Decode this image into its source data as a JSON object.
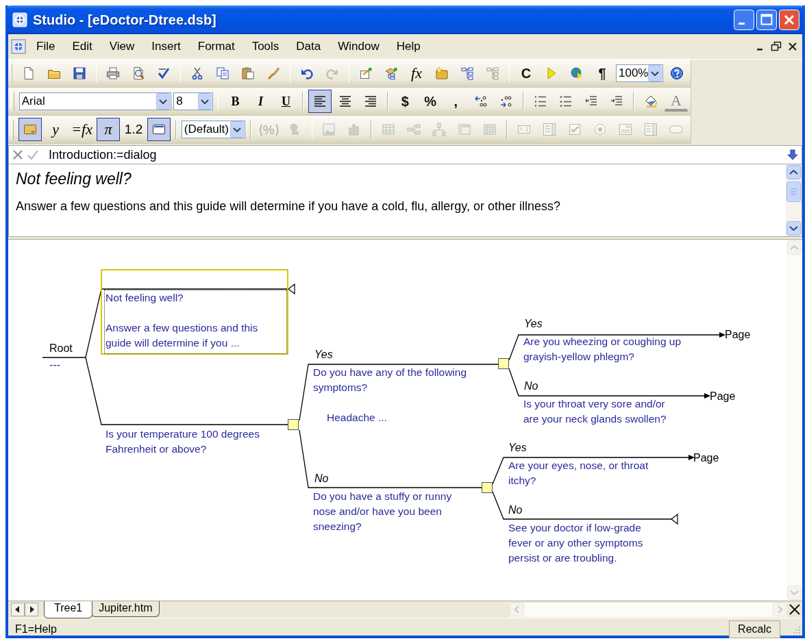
{
  "window": {
    "title": "Studio - [eDoctor-Dtree.dsb]"
  },
  "menu": [
    {
      "label": "File"
    },
    {
      "label": "Edit"
    },
    {
      "label": "View"
    },
    {
      "label": "Insert"
    },
    {
      "label": "Format"
    },
    {
      "label": "Tools"
    },
    {
      "label": "Data"
    },
    {
      "label": "Window"
    },
    {
      "label": "Help"
    }
  ],
  "toolbars": [
    [
      {
        "kind": "icon",
        "disabled": false,
        "pressed": false
      },
      {
        "kind": "icon",
        "disabled": false,
        "pressed": false
      },
      {
        "kind": "icon",
        "disabled": false,
        "pressed": false
      },
      {
        "kind": "separator"
      },
      {
        "kind": "icon",
        "disabled": false,
        "pressed": false
      },
      {
        "kind": "icon",
        "disabled": false,
        "pressed": false
      },
      {
        "kind": "icon",
        "disabled": false,
        "pressed": false
      },
      {
        "kind": "separator"
      },
      {
        "kind": "icon",
        "disabled": false,
        "pressed": false
      },
      {
        "kind": "icon",
        "disabled": false,
        "pressed": false
      },
      {
        "kind": "icon",
        "disabled": false,
        "pressed": false
      },
      {
        "kind": "icon",
        "disabled": false,
        "pressed": false
      },
      {
        "kind": "separator"
      },
      {
        "kind": "icon",
        "disabled": false,
        "pressed": false
      },
      {
        "kind": "icon",
        "disabled": true,
        "pressed": false
      },
      {
        "kind": "separator"
      },
      {
        "kind": "icon",
        "disabled": false,
        "pressed": false
      },
      {
        "kind": "icon",
        "disabled": false,
        "pressed": false
      },
      {
        "kind": "formula",
        "label": "fx",
        "disabled": false,
        "pressed": false
      },
      {
        "kind": "icon",
        "disabled": false,
        "pressed": false
      },
      {
        "kind": "icon",
        "disabled": false,
        "pressed": false
      },
      {
        "kind": "icon",
        "disabled": true,
        "pressed": false
      },
      {
        "kind": "separator"
      },
      {
        "kind": "text",
        "label": "C",
        "disabled": false,
        "pressed": false
      },
      {
        "kind": "icon",
        "disabled": false,
        "pressed": false
      },
      {
        "kind": "icon",
        "disabled": false,
        "pressed": false
      },
      {
        "kind": "text",
        "label": "¶",
        "disabled": false,
        "pressed": false
      },
      {
        "kind": "combo",
        "value": "100%"
      },
      {
        "kind": "icon",
        "disabled": false,
        "pressed": false
      }
    ],
    [
      {
        "kind": "combo",
        "value": "Arial"
      },
      {
        "kind": "combo",
        "value": "8"
      },
      {
        "kind": "separator"
      },
      {
        "kind": "bold",
        "label": "B",
        "disabled": false,
        "pressed": false
      },
      {
        "kind": "italic",
        "label": "I",
        "disabled": false,
        "pressed": false
      },
      {
        "kind": "underline",
        "label": "U",
        "disabled": false,
        "pressed": false
      },
      {
        "kind": "separator"
      },
      {
        "kind": "icon",
        "disabled": false,
        "pressed": true
      },
      {
        "kind": "icon",
        "disabled": false,
        "pressed": false
      },
      {
        "kind": "icon",
        "disabled": false,
        "pressed": false
      },
      {
        "kind": "separator"
      },
      {
        "kind": "text",
        "label": "$",
        "disabled": false,
        "pressed": false
      },
      {
        "kind": "text",
        "label": "%",
        "disabled": false,
        "pressed": false
      },
      {
        "kind": "text",
        "label": ",",
        "disabled": false,
        "pressed": false
      },
      {
        "kind": "icon",
        "disabled": false,
        "pressed": false
      },
      {
        "kind": "icon",
        "disabled": false,
        "pressed": false
      },
      {
        "kind": "separator"
      },
      {
        "kind": "icon",
        "disabled": false,
        "pressed": false
      },
      {
        "kind": "icon",
        "disabled": false,
        "pressed": false
      },
      {
        "kind": "icon",
        "disabled": false,
        "pressed": false
      },
      {
        "kind": "icon",
        "disabled": false,
        "pressed": false
      },
      {
        "kind": "separator"
      },
      {
        "kind": "icon",
        "disabled": false,
        "pressed": false
      },
      {
        "kind": "font-color",
        "label": "A",
        "disabled": false,
        "pressed": false
      }
    ],
    [
      {
        "kind": "icon",
        "disabled": false,
        "pressed": true
      },
      {
        "kind": "formula",
        "label": "y",
        "disabled": false,
        "pressed": false
      },
      {
        "kind": "formula",
        "label": "=fx",
        "disabled": false,
        "pressed": false
      },
      {
        "kind": "formula",
        "label": "π",
        "disabled": false,
        "pressed": true
      },
      {
        "kind": "number",
        "label": "1.2",
        "disabled": false,
        "pressed": false
      },
      {
        "kind": "icon",
        "disabled": false,
        "pressed": true
      },
      {
        "kind": "separator"
      },
      {
        "kind": "combo",
        "value": "(Default)"
      },
      {
        "kind": "separator"
      },
      {
        "kind": "number",
        "label": "⟨%⟩",
        "disabled": true,
        "pressed": false
      },
      {
        "kind": "icon",
        "disabled": true,
        "pressed": false
      },
      {
        "kind": "separator"
      },
      {
        "kind": "icon",
        "disabled": true,
        "pressed": false
      },
      {
        "kind": "icon",
        "disabled": true,
        "pressed": false
      },
      {
        "kind": "separator"
      },
      {
        "kind": "icon",
        "disabled": true,
        "pressed": false
      },
      {
        "kind": "icon",
        "disabled": true,
        "pressed": false
      },
      {
        "kind": "icon",
        "disabled": true,
        "pressed": false
      },
      {
        "kind": "icon",
        "disabled": true,
        "pressed": false
      },
      {
        "kind": "icon",
        "disabled": true,
        "pressed": false
      },
      {
        "kind": "separator"
      },
      {
        "kind": "icon",
        "disabled": true,
        "pressed": false
      },
      {
        "kind": "icon",
        "disabled": true,
        "pressed": false
      },
      {
        "kind": "icon",
        "disabled": true,
        "pressed": false
      },
      {
        "kind": "icon",
        "disabled": true,
        "pressed": false
      },
      {
        "kind": "icon",
        "disabled": true,
        "pressed": false
      },
      {
        "kind": "icon",
        "disabled": true,
        "pressed": false
      },
      {
        "kind": "icon",
        "disabled": true,
        "pressed": false
      }
    ]
  ],
  "formula_bar": {
    "text": "Introduction:=dialog"
  },
  "intro": {
    "heading": "Not feeling well?",
    "text": "Answer a few questions and this guide will determine if you have a cold, flu, allergy, or other illness?"
  },
  "tree": {
    "root": {
      "label": "Root",
      "value": "---"
    },
    "children": [
      {
        "kind": "dialog",
        "title": "Not feeling well?",
        "text": "Answer a few questions and this guide will determine if you ..."
      },
      {
        "kind": "question",
        "text": "Is your temperature 100 degrees Fahrenheit or above?",
        "children": [
          {
            "kind": "question",
            "branch": "Yes",
            "text": "Do you have any of the following symptoms?",
            "note": "Headache ...",
            "children": [
              {
                "kind": "page",
                "branch": "Yes",
                "text": "Are you wheezing or coughing up grayish-yellow phlegm?",
                "target": "Page"
              },
              {
                "kind": "page",
                "branch": "No",
                "text": "Is your throat very sore and/or are your neck glands swollen?",
                "target": "Page"
              }
            ]
          },
          {
            "kind": "question",
            "branch": "No",
            "text": "Do you have a stuffy or runny nose and/or have you been sneezing?",
            "children": [
              {
                "kind": "page",
                "branch": "Yes",
                "text": "Are your eyes, nose, or throat itchy?",
                "target": "Page"
              },
              {
                "kind": "message",
                "branch": "No",
                "text": "See your doctor if low-grade fever or any other symptoms persist or are troubling."
              }
            ]
          }
        ]
      }
    ]
  },
  "sheet_tabs": [
    {
      "label": "Tree1",
      "selected": true
    },
    {
      "label": "Jupiter.htm",
      "selected": false
    }
  ],
  "status_bar": {
    "message": "F1=Help",
    "indicator": "Recalc"
  }
}
